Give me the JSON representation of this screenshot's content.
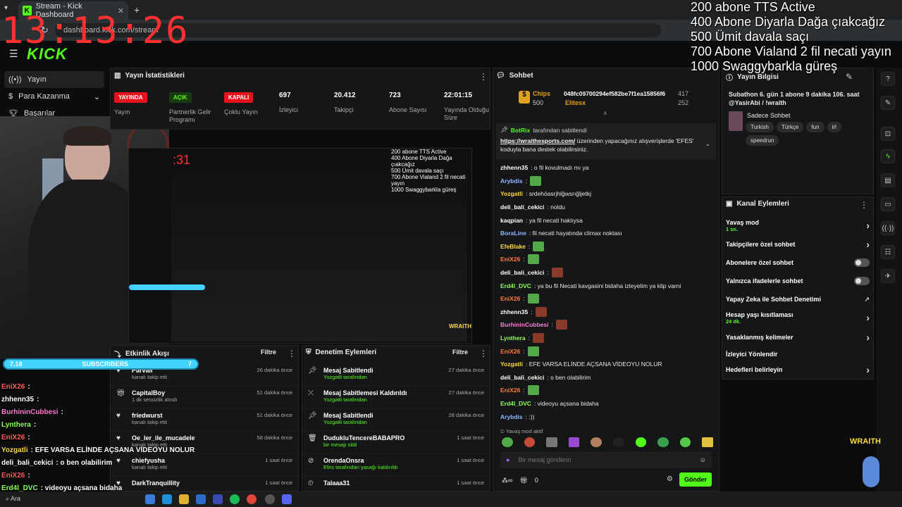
{
  "browser": {
    "tab_title": "Stream - Kick Dashboard",
    "new_tab": "+",
    "url": "dashboard.kick.com/stream"
  },
  "overlay": {
    "clock": "13:13:26",
    "goals": [
      "200 abone TTS Active",
      "400 Abone Diyarla Dağa çıakcağız",
      "500 Ümit davala saçı",
      "700 Abone Vialand 2 fil necati yayın",
      "1000 Swaggybarkla güreş"
    ],
    "subs_bar": {
      "left": "7.18",
      "label": "SUBSCRIBERS",
      "right": "7"
    },
    "sponsor_logo": "WRAITH",
    "chat": [
      {
        "name": "EniX26",
        "msg": ":",
        "color": "#ff5a5a"
      },
      {
        "name": "zhhenn35",
        "msg": ":",
        "color": "#ffffff"
      },
      {
        "name": "BurhininCubbesi",
        "msg": ":",
        "color": "#ff7bd1"
      },
      {
        "name": "Lynthera",
        "msg": ":",
        "color": "#8cff5a"
      },
      {
        "name": "EniX26",
        "msg": ":",
        "color": "#ff5a5a"
      },
      {
        "name": "Yozgatli",
        "msg": ": EFE VARSA ELİNDE AÇSANA VİDEOYU NOLUR",
        "color": "#ffd84a"
      },
      {
        "name": "deli_bali_cekici",
        "msg": ": o ben olabilirim",
        "color": "#ffffff"
      },
      {
        "name": "EniX26",
        "msg": ":",
        "color": "#ff5a5a"
      },
      {
        "name": "Erd4l_DVC",
        "msg": ": videoyu açsana bidaha",
        "color": "#8cff5a"
      }
    ]
  },
  "sidebar": {
    "items": [
      {
        "label": "Yayın",
        "icon": "broadcast-icon"
      },
      {
        "label": "Para Kazanma",
        "icon": "money-icon"
      },
      {
        "label": "Başarılar",
        "icon": "trophy-icon"
      }
    ]
  },
  "stats": {
    "title": "Yayın İstatistikleri",
    "items": [
      {
        "badge": "YAYINDA",
        "label": "Yayın",
        "color": "#e8121d"
      },
      {
        "badge": "AÇIK",
        "label": "Partnerlik Gelir Programı",
        "color": "#53fc18"
      },
      {
        "badge": "KAPALI",
        "label": "Çoklu Yayın",
        "color": "#e8121d"
      },
      {
        "value": "697",
        "label": "İzleyici"
      },
      {
        "value": "20.412",
        "label": "Takipçi"
      },
      {
        "value": "723",
        "label": "Abone Sayısı"
      },
      {
        "value": "22:01:15",
        "label": "Yayında Olduğu Süre"
      }
    ]
  },
  "activity": {
    "title": "Etkinlik Akışı",
    "filter": "Filtre",
    "rows": [
      {
        "name": "Parvali",
        "sub": "kanalı takip etti",
        "time": "26 dakika önce",
        "icon": "heart-icon"
      },
      {
        "name": "CapitalBoy",
        "sub": "1 dk sessizlik alındı",
        "time": "51 dakika önce",
        "icon": "gift-icon"
      },
      {
        "name": "friedwurst",
        "sub": "kanalı takip etti",
        "time": "51 dakika önce",
        "icon": "heart-icon"
      },
      {
        "name": "Oe_ler_ile_mucadele",
        "sub": "kanalı takip etti",
        "time": "58 dakika önce",
        "icon": "heart-icon"
      },
      {
        "name": "chiefyusha",
        "sub": "kanalı takip etti",
        "time": "1 saat önce",
        "icon": "heart-icon"
      },
      {
        "name": "DarkTranquillity",
        "sub": "",
        "time": "1 saat önce",
        "icon": "heart-icon"
      }
    ]
  },
  "moderation": {
    "title": "Denetim Eylemleri",
    "filter": "Filtre",
    "rows": [
      {
        "name": "Mesaj Sabitlendi",
        "sub": "Yozgatli tarafından",
        "time": "27 dakika önce",
        "icon": "pin-icon"
      },
      {
        "name": "Mesaj Sabitlemesi Kaldırıldı",
        "sub": "Yozgatli tarafından",
        "time": "27 dakika önce",
        "icon": "unpin-icon"
      },
      {
        "name": "Mesaj Sabitlendi",
        "sub": "Yozgatli tarafından",
        "time": "28 dakika önce",
        "icon": "pin-icon"
      },
      {
        "name": "DudukluTencereBABAPRO",
        "sub": "bir mesajı sildi",
        "time": "1 saat önce",
        "icon": "trash-icon"
      },
      {
        "name": "OrendaOnsra",
        "sub": "Efes tarafından yasağı kaldırıldı",
        "time": "1 saat önce",
        "icon": "unban-icon"
      },
      {
        "name": "Talaaa31",
        "sub": "",
        "time": "1 saat önce",
        "icon": "clock-icon"
      }
    ]
  },
  "chat": {
    "title": "Sohbet",
    "chips_label": "Chips",
    "chips_value": "500",
    "top_user": "048fc09700294ef582be7f1ea15856f6",
    "top_user_count": "417",
    "elite": "Elitesx",
    "elite_count": "252",
    "pinned_by": "BotRix",
    "pinned_suffix": "tarafından sabitlendi",
    "pinned_link": "https://wraithesports.com/",
    "pinned_text": " üzerinden yapacağınız alışverişlerde 'EFES' koduyla bana destek olabilirsiniz.",
    "messages": [
      {
        "name": "zhhenn35",
        "text": ": o fil kovulmadı mı ya",
        "color": "#ffffff"
      },
      {
        "name": "Arybdis",
        "text": ":",
        "color": "#8fb8ff",
        "emote": "#53a84a"
      },
      {
        "name": "Yozgatli",
        "text": ": srdehöasrjhlğwsrığljetkj",
        "color": "#ffd84a"
      },
      {
        "name": "deli_bali_cekici",
        "text": ": noldu",
        "color": "#ffffff"
      },
      {
        "name": "kaqpian",
        "text": ": ya fil necati haklıysa",
        "color": "#ffffff"
      },
      {
        "name": "BoraLine",
        "text": ": fil necati hayatında climax noktası",
        "color": "#8fb8ff"
      },
      {
        "name": "EfeBlake",
        "text": ":",
        "color": "#ffd84a",
        "emote": "#53a84a"
      },
      {
        "name": "EniX26",
        "text": ":",
        "color": "#ff7a3a",
        "emote": "#53a84a"
      },
      {
        "name": "deli_bali_cekici",
        "text": ":",
        "color": "#ffffff",
        "emote": "#8a3a2a"
      },
      {
        "name": "Erd4l_DVC",
        "text": ": ya bu fil Necati kavgasini bidaha izleyelim ya klip varni",
        "color": "#8cff5a"
      },
      {
        "name": "EniX26",
        "text": ":",
        "color": "#ff7a3a",
        "emote": "#53a84a"
      },
      {
        "name": "zhhenn35",
        "text": ":",
        "color": "#ffffff",
        "emote": "#8a3a2a"
      },
      {
        "name": "BurhininCubbesi",
        "text": ":",
        "color": "#ff7bd1",
        "emote": "#8a3a2a"
      },
      {
        "name": "Lynthera",
        "text": ":",
        "color": "#8cff5a",
        "emote": "#8a3a2a"
      },
      {
        "name": "EniX26",
        "text": ":",
        "color": "#ff7a3a",
        "emote": "#53a84a"
      },
      {
        "name": "Yozgatli",
        "text": ": EFE VARSA ELİNDE AÇSANA VİDEOYU NOLUR",
        "color": "#ffd84a"
      },
      {
        "name": "deli_bali_cekici",
        "text": ": o ben olabilirim",
        "color": "#ffffff"
      },
      {
        "name": "EniX26",
        "text": ":",
        "color": "#ff7a3a",
        "emote": "#53a84a"
      },
      {
        "name": "Erd4l_DVC",
        "text": ": videoyu açsana bidaha",
        "color": "#8cff5a"
      },
      {
        "name": "Arybdis",
        "text": ": :))",
        "color": "#8fb8ff"
      }
    ],
    "slow_mode": "Yavaş mod aktif",
    "placeholder": "Bir mesaj gönderin",
    "count": "0",
    "send": "Gönder"
  },
  "stream_info": {
    "title": "Yayın Bilgisi",
    "description": "Subathon 6. gün 1 abone 9 dakika 106. saat @YasirAbi / !wraith",
    "category": "Sadece Sohbet",
    "tags": [
      "Turkish",
      "Türkçe",
      "fun",
      "irl",
      "speedrun"
    ]
  },
  "channel_actions": {
    "title": "Kanal Eylemleri",
    "rows": [
      {
        "label": "Yavaş mod",
        "sub": "1 sn.",
        "control": "chevron"
      },
      {
        "label": "Takipçilere özel sohbet",
        "sub": "",
        "control": "chevron"
      },
      {
        "label": "Abonelere özel sohbet",
        "sub": "",
        "control": "toggle"
      },
      {
        "label": "Yalnızca ifadelerle sohbet",
        "sub": "",
        "control": "toggle"
      },
      {
        "label": "Yapay Zeka ile Sohbet Denetimi",
        "sub": "",
        "control": "external"
      },
      {
        "label": "Hesap yaşı kısıtlaması",
        "sub": "24 dk.",
        "control": "chevron"
      },
      {
        "label": "Yasaklanmış kelimeler",
        "sub": "",
        "control": "chevron"
      },
      {
        "label": "İzleyici Yönlendir",
        "sub": "",
        "control": "none"
      },
      {
        "label": "Hedefleri belirleyin",
        "sub": "",
        "control": "chevron"
      }
    ]
  },
  "taskbar": {
    "search": "Ara"
  }
}
